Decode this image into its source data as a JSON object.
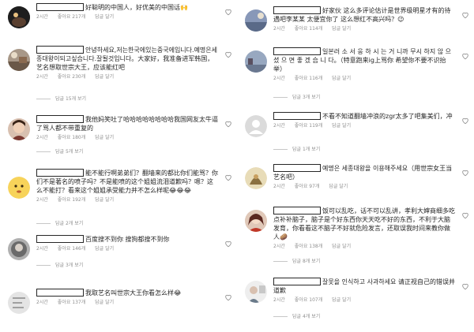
{
  "left": [
    {
      "text": "好聪明的中国人，好优美的中国话🙌",
      "time": "2시간",
      "likes": "좋아요 217개",
      "reply": "답글 달기",
      "replies": null
    },
    {
      "text": "안녕하세요,저는한국에있는중국에입니다.예명은세종대왕이되고싶습니다.잘될것입니다。大家好，我准备进军韩国，艺名想取世宗大王，应该能红吧",
      "time": "2시간",
      "likes": "좋아요 230개",
      "reply": "답글 달기",
      "replies": "답글 15개 보기"
    },
    {
      "text": "我他妈笑吐了哈哈哈哈哈哈哈哈我国网友太牛逼了骂人都不带重复的",
      "time": "2시간",
      "likes": "좋아요 180개",
      "reply": "답글 달기",
      "replies": "답글 5개 보기"
    },
    {
      "text": "能不能行啊弟弟们？翻墙来的都比你们能骂？你们不是著名的喷子吗？不是能喷的这个姐姐流泪道歉吗？嗯？这么不能打？看来这个姐姐承受能力并不怎么样呢😂😂😂",
      "time": "2시간",
      "likes": "좋아요 192개",
      "reply": "답글 달기",
      "replies": "답글 2개 보기"
    },
    {
      "text": "百度搜不到你 搜狗都搜不到你",
      "time": "2시간",
      "likes": "좋아요 146개",
      "reply": "답글 달기",
      "replies": "답글 3개 보기"
    },
    {
      "text": "我取艺名叫世宗大王你看怎么样😂",
      "time": "2시간",
      "likes": "좋아요 137개",
      "reply": "답글 달기",
      "replies": null
    }
  ],
  "right": [
    {
      "text": "好家伙 这么多评论估计是世界级明星才有的待遇吧李某某 太便宜你了 这么想红不高兴吗？😉",
      "time": "2시간",
      "likes": "좋아요 114개",
      "reply": "답글 달기",
      "replies": null
    },
    {
      "text": "일본러 소 서 웅 하 시 는 거 니까 무시 하지 않 으 셨 으 면 좋 겠 습 니 다。（特意跑来ig上骂你 希望你不要不识抬举）",
      "time": "2시간",
      "likes": "좋아요 116개",
      "reply": "답글 달기",
      "replies": "답글 3개 보기"
    },
    {
      "text": "不看不知道翻墙冲浪的zgr太多了吧集美们，冲",
      "time": "2시간",
      "likes": "좋아요 119개",
      "reply": "답글 달기",
      "replies": "답글 1개 보기"
    },
    {
      "text": "예명은 세종대왕을 이용해주세요（用世宗女王当艺名吧）",
      "time": "2시간",
      "likes": "좋아요 97개",
      "reply": "답글 달기",
      "replies": null
    },
    {
      "text": "饭可以乱吃，话不可以乱讲，孝利大婶商细多吃点补补脑子，脑子是个好东西你天天吃不好的东西，不利于大脑发育，你看看这不脑子不好就危险发言，还取误我时间来教你做人🥔",
      "time": "2시간",
      "likes": "좋아요 138개",
      "reply": "답글 달기",
      "replies": "답글 8개 보기"
    },
    {
      "text": "잘못을 인식하고 사과하세요 请正视自己的错误并道歉",
      "time": "2시간",
      "likes": "좋아요 107개",
      "reply": "답글 달기",
      "replies": "답글 4개 보기"
    }
  ],
  "avatar_colors": {
    "left": [
      "#2b2b2b",
      "#8a7a6a",
      "#7a5040",
      "#f2d060",
      "#9a9a9a",
      "#d8d8d8"
    ],
    "right": [
      "#6a7a98",
      "#7a8aa0",
      "#d0d0d0",
      "#d4c090",
      "#b06050",
      "#e0e0e0"
    ]
  }
}
